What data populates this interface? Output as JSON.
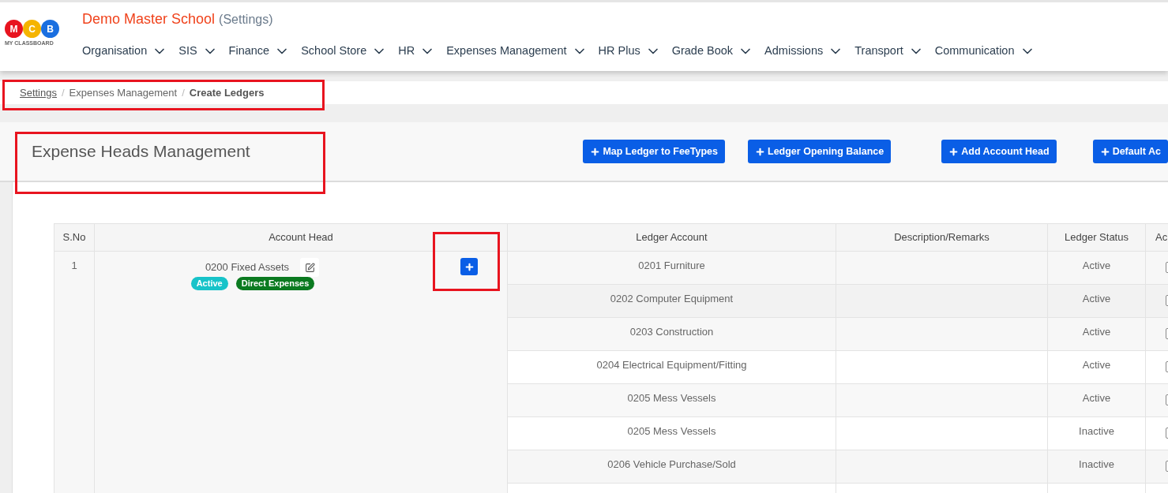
{
  "header": {
    "logo_letters": [
      {
        "letter": "M",
        "color": "#e8141f"
      },
      {
        "letter": "C",
        "color": "#f5b400"
      },
      {
        "letter": "B",
        "color": "#1a6fe0"
      }
    ],
    "logo_caption": "MY CLASSBOARD",
    "school_name": "Demo Master School",
    "context": "(Settings)",
    "nav": [
      {
        "label": "Organisation"
      },
      {
        "label": "SIS"
      },
      {
        "label": "Finance"
      },
      {
        "label": "School Store"
      },
      {
        "label": "HR"
      },
      {
        "label": "Expenses Management"
      },
      {
        "label": "HR Plus"
      },
      {
        "label": "Grade Book"
      },
      {
        "label": "Admissions"
      },
      {
        "label": "Transport"
      },
      {
        "label": "Communication"
      }
    ]
  },
  "breadcrumb_separator": "/",
  "breadcrumb": [
    {
      "label": "Settings",
      "kind": "link"
    },
    {
      "label": "Expenses Management",
      "kind": "text"
    },
    {
      "label": "Create Ledgers",
      "kind": "current"
    }
  ],
  "page_title": "Expense Heads Management",
  "actions": [
    "Map Ledger to FeeTypes",
    "Ledger Opening Balance",
    "Add Account Head",
    "Default Ac"
  ],
  "table": {
    "columns": [
      "S.No",
      "Account Head",
      "Ledger Account",
      "Description/Remarks",
      "Ledger Status",
      "Ac"
    ],
    "account_head": {
      "sno": "1",
      "name": "0200 Fixed Assets",
      "tags": [
        {
          "label": "Active",
          "color": "#17c3c9"
        },
        {
          "label": "Direct Expenses",
          "color": "#0b7a20"
        }
      ]
    },
    "rows": [
      {
        "ledger": "0201 Furniture",
        "status": "Active"
      },
      {
        "ledger": "0202 Computer Equipment",
        "status": "Active"
      },
      {
        "ledger": "0203 Construction",
        "status": "Active"
      },
      {
        "ledger": "0204 Electrical Equipment/Fitting",
        "status": "Active"
      },
      {
        "ledger": "0205 Mess Vessels",
        "status": "Active"
      },
      {
        "ledger": "0205 Mess Vessels",
        "status": "Inactive"
      },
      {
        "ledger": "0206 Vehicle Purchase/Sold",
        "status": "Inactive"
      }
    ]
  }
}
